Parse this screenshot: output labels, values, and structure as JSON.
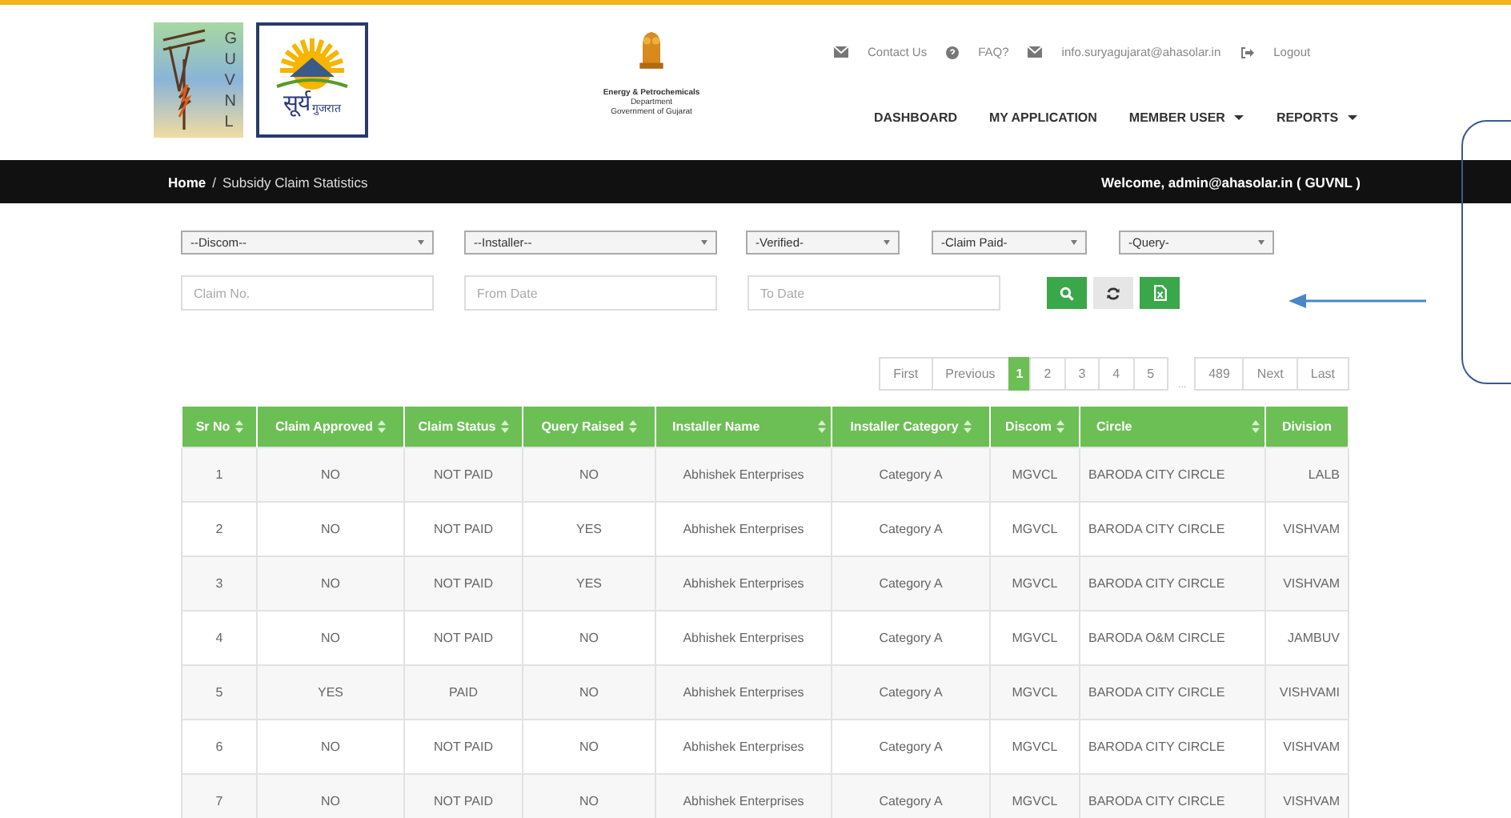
{
  "header": {
    "guvnl_logo": {
      "letters": [
        "G",
        "U",
        "V",
        "N",
        "L"
      ]
    },
    "surya_logo": {
      "text": "सूर्य",
      "subtext": "गुजरात"
    },
    "emblem": {
      "lines": [
        "Energy & Petrochemicals",
        "Department",
        "Government of Gujarat"
      ]
    },
    "top_links": [
      {
        "kind": "mail",
        "label": "Contact Us"
      },
      {
        "kind": "help",
        "label": "FAQ?"
      },
      {
        "kind": "mail",
        "label": "info.suryagujarat@ahasolar.in"
      },
      {
        "kind": "logout",
        "label": "Logout"
      }
    ],
    "nav": [
      {
        "label": "DASHBOARD",
        "dropdown": false
      },
      {
        "label": "MY APPLICATION",
        "dropdown": false
      },
      {
        "label": "MEMBER USER",
        "dropdown": true
      },
      {
        "label": "REPORTS",
        "dropdown": true
      }
    ]
  },
  "breadcrumb": {
    "items": [
      "Home",
      "Subsidy Claim Statistics"
    ],
    "separator": "/",
    "welcome": "Welcome, admin@ahasolar.in ( GUVNL )"
  },
  "filters": {
    "selects": [
      "--Discom--",
      "--Installer--",
      "-Verified-",
      "-Claim Paid-",
      "-Query-"
    ],
    "inputs": [
      {
        "placeholder": "Claim No."
      },
      {
        "placeholder": "From Date"
      },
      {
        "placeholder": "To Date"
      }
    ],
    "buttons": [
      {
        "kind": "search"
      },
      {
        "kind": "refresh"
      },
      {
        "kind": "excel"
      }
    ]
  },
  "pagination": [
    {
      "kind": "page",
      "label": "First",
      "selected": false
    },
    {
      "kind": "page",
      "label": "Previous",
      "selected": false
    },
    {
      "kind": "page",
      "label": "1",
      "selected": true
    },
    {
      "kind": "page",
      "label": "2",
      "selected": false
    },
    {
      "kind": "page",
      "label": "3",
      "selected": false
    },
    {
      "kind": "page",
      "label": "4",
      "selected": false
    },
    {
      "kind": "page",
      "label": "5",
      "selected": false
    },
    {
      "kind": "ellipsis",
      "label": "..."
    },
    {
      "kind": "page",
      "label": "489",
      "selected": false
    },
    {
      "kind": "page",
      "label": "Next",
      "selected": false
    },
    {
      "kind": "page",
      "label": "Last",
      "selected": false
    }
  ],
  "table": {
    "columns": [
      {
        "label": "Sr No",
        "sortable": true
      },
      {
        "label": "Claim Approved",
        "sortable": true
      },
      {
        "label": "Claim Status",
        "sortable": true
      },
      {
        "label": "Query Raised",
        "sortable": true
      },
      {
        "label": "Installer Name",
        "sortable": true
      },
      {
        "label": "Installer Category",
        "sortable": true
      },
      {
        "label": "Discom",
        "sortable": true
      },
      {
        "label": "Circle",
        "sortable": true
      },
      {
        "label": "Division",
        "sortable": false
      }
    ],
    "rows": [
      [
        "1",
        "NO",
        "NOT PAID",
        "NO",
        "Abhishek Enterprises",
        "Category A",
        "MGVCL",
        "BARODA CITY CIRCLE",
        "LALB"
      ],
      [
        "2",
        "NO",
        "NOT PAID",
        "YES",
        "Abhishek Enterprises",
        "Category A",
        "MGVCL",
        "BARODA CITY CIRCLE",
        "VISHVAM"
      ],
      [
        "3",
        "NO",
        "NOT PAID",
        "YES",
        "Abhishek Enterprises",
        "Category A",
        "MGVCL",
        "BARODA CITY CIRCLE",
        "VISHVAM"
      ],
      [
        "4",
        "NO",
        "NOT PAID",
        "NO",
        "Abhishek Enterprises",
        "Category A",
        "MGVCL",
        "BARODA O&M CIRCLE",
        "JAMBUV"
      ],
      [
        "5",
        "YES",
        "PAID",
        "NO",
        "Abhishek Enterprises",
        "Category A",
        "MGVCL",
        "BARODA CITY CIRCLE",
        "VISHVAMI"
      ],
      [
        "6",
        "NO",
        "NOT PAID",
        "NO",
        "Abhishek Enterprises",
        "Category A",
        "MGVCL",
        "BARODA CITY CIRCLE",
        "VISHVAM"
      ],
      [
        "7",
        "NO",
        "NOT PAID",
        "NO",
        "Abhishek Enterprises",
        "Category A",
        "MGVCL",
        "BARODA CITY CIRCLE",
        "VISHVAM"
      ]
    ]
  }
}
